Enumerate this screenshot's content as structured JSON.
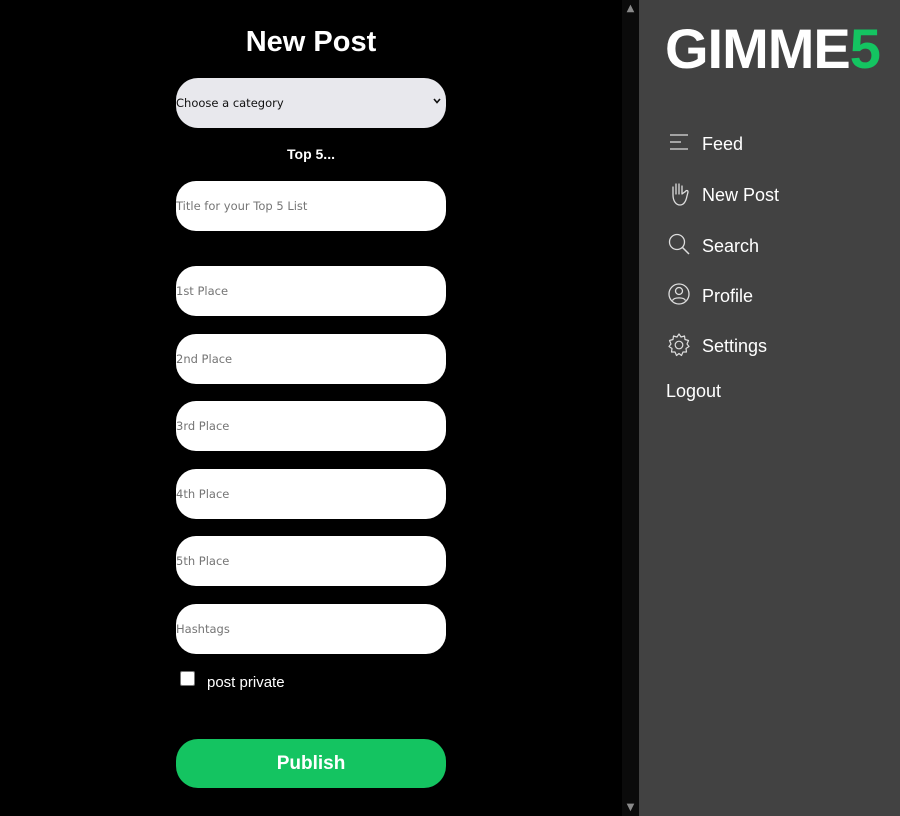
{
  "form": {
    "heading": "New Post",
    "category_select": {
      "value": "Choose a category"
    },
    "top5_label": "Top 5...",
    "title_placeholder": "Title for your Top 5 List",
    "places": [
      {
        "placeholder": "1st Place"
      },
      {
        "placeholder": "2nd Place"
      },
      {
        "placeholder": "3rd Place"
      },
      {
        "placeholder": "4th Place"
      },
      {
        "placeholder": "5th Place"
      }
    ],
    "hashtags_placeholder": "Hashtags",
    "private_label": "post private",
    "private_checked": false,
    "publish_label": "Publish"
  },
  "sidebar": {
    "logo": {
      "main": "GIMME",
      "accent": "5"
    },
    "items": [
      {
        "label": "Feed",
        "icon": "feed-lines-icon"
      },
      {
        "label": "New Post",
        "icon": "hand-icon"
      },
      {
        "label": "Search",
        "icon": "search-icon"
      },
      {
        "label": "Profile",
        "icon": "profile-icon"
      },
      {
        "label": "Settings",
        "icon": "gear-icon"
      }
    ],
    "logout_label": "Logout"
  },
  "colors": {
    "accent": "#14c461",
    "sidebar_bg": "#424242",
    "main_bg": "#000000",
    "select_bg": "#e8e8ed"
  }
}
